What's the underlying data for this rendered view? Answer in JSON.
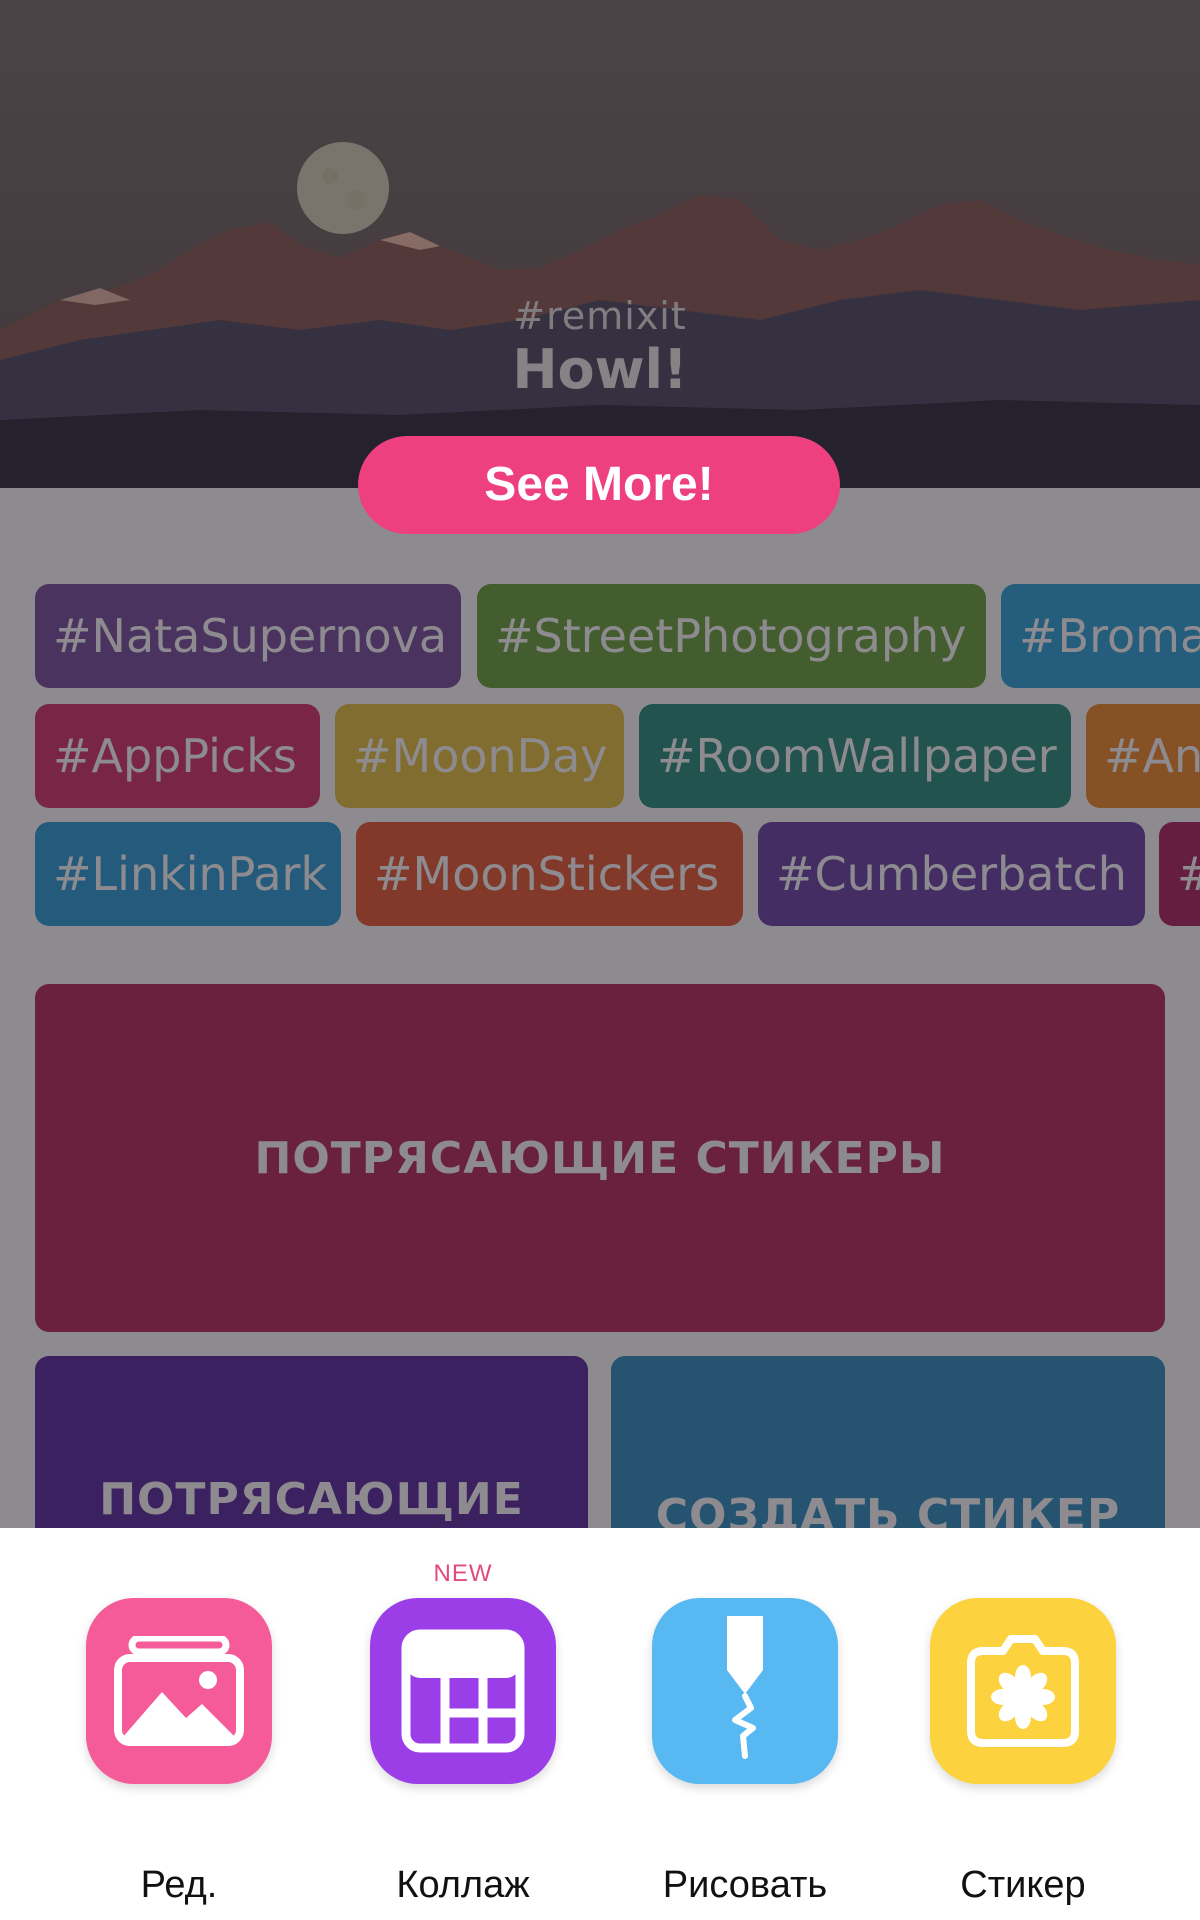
{
  "hero": {
    "hashtag": "#remixit",
    "title": "Howl!",
    "button_label": "See More!"
  },
  "tags": [
    [
      {
        "label": "#NataSupernova",
        "color": "#7b4fa0"
      },
      {
        "label": "#StreetPhotography",
        "color": "#6aa33d"
      },
      {
        "label": "#Broma",
        "color": "#2ea4d8"
      }
    ],
    [
      {
        "label": "#AppPicks",
        "color": "#d6356c"
      },
      {
        "label": "#MoonDay",
        "color": "#e7c33f"
      },
      {
        "label": "#RoomWallpaper",
        "color": "#2a8f7c"
      },
      {
        "label": "#An",
        "color": "#f08a2a"
      }
    ],
    [
      {
        "label": "#LinkinPark",
        "color": "#2d9ed9"
      },
      {
        "label": "#MoonStickers",
        "color": "#ea5a33"
      },
      {
        "label": "#Cumberbatch",
        "color": "#6b43a6"
      },
      {
        "label": "#",
        "color": "#b12561"
      }
    ]
  ],
  "cards": {
    "big": {
      "label": "ПОТРЯСАЮЩИЕ СТИКЕРЫ",
      "color": "#b92b58"
    },
    "left": {
      "label": "ПОТРЯСАЮЩИЕ",
      "color": "#5a2aa0"
    },
    "right": {
      "label": "СОЗДАТЬ СТИКЕР",
      "color": "#2f8fc0"
    }
  },
  "actions": [
    {
      "label": "Ред.",
      "icon": "photo-icon",
      "color": "#f45b98"
    },
    {
      "label": "Коллаж",
      "icon": "collage-grid-icon",
      "color": "#9b3ee8",
      "badge": "NEW"
    },
    {
      "label": "Рисовать",
      "icon": "pen-draw-icon",
      "color": "#58b8f2"
    },
    {
      "label": "Стикер",
      "icon": "sticker-camera-icon",
      "color": "#fdd23f"
    }
  ]
}
